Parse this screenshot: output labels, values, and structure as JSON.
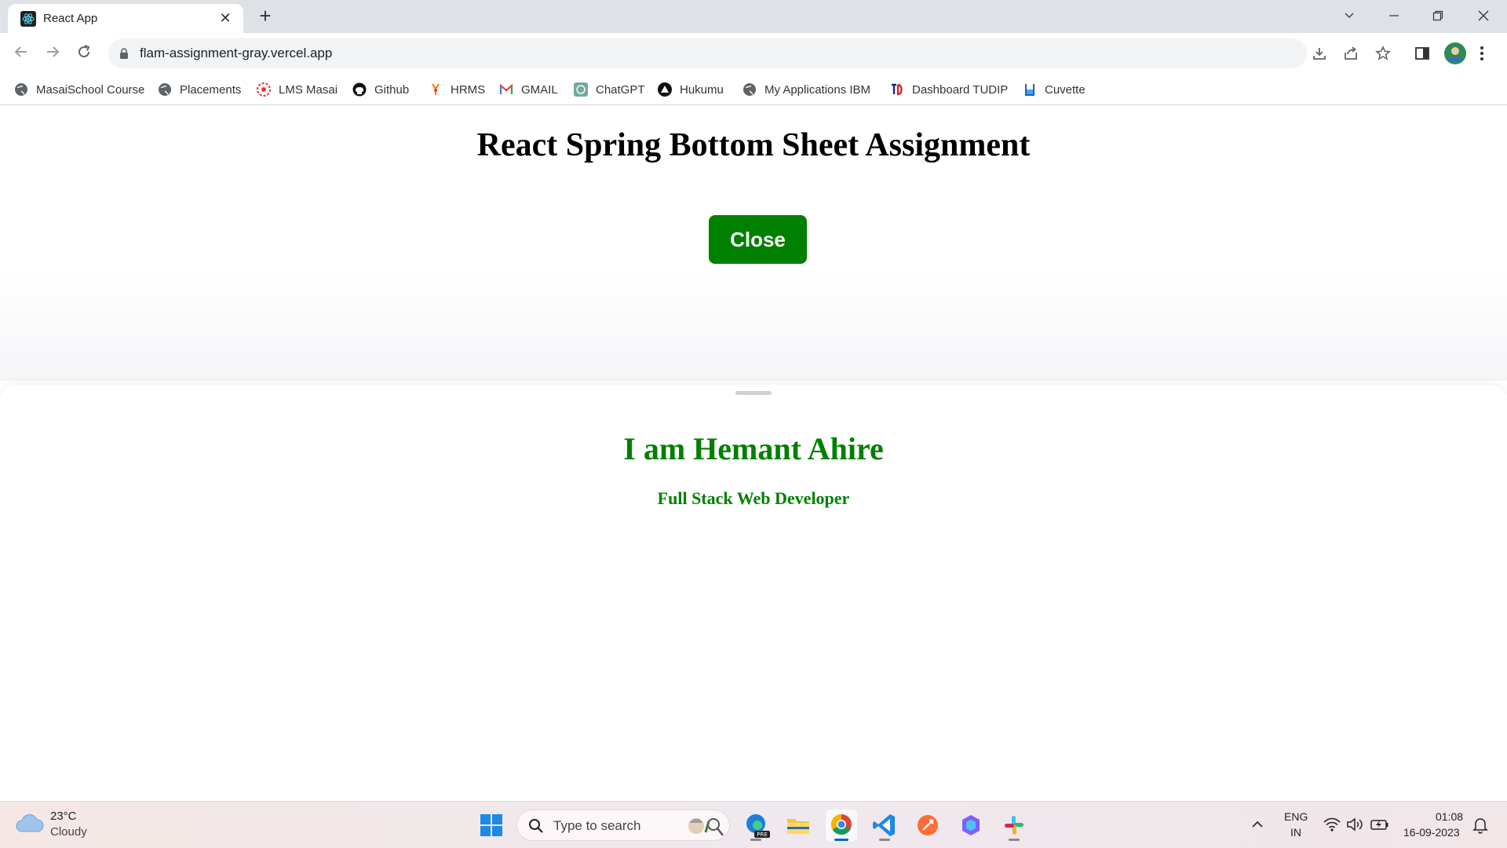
{
  "browser": {
    "tab_title": "React App",
    "tab_close": "✕",
    "new_tab": "+",
    "url": "flam-assignment-gray.vercel.app",
    "bookmarks": [
      {
        "label": "MasaiSchool Course",
        "icon": "globe-icon"
      },
      {
        "label": "Placements",
        "icon": "globe-icon"
      },
      {
        "label": "LMS Masai",
        "icon": "lms-icon"
      },
      {
        "label": "Github",
        "icon": "github-icon"
      },
      {
        "label": "HRMS",
        "icon": "hrms-icon"
      },
      {
        "label": "GMAIL",
        "icon": "gmail-icon"
      },
      {
        "label": "ChatGPT",
        "icon": "chatgpt-icon"
      },
      {
        "label": "Hukumu",
        "icon": "hukumu-icon"
      },
      {
        "label": "My Applications IBM",
        "icon": "globe-icon"
      },
      {
        "label": "Dashboard TUDIP",
        "icon": "tudip-icon"
      },
      {
        "label": "Cuvette",
        "icon": "cuvette-icon"
      }
    ]
  },
  "page": {
    "title": "React Spring Bottom Sheet Assignment",
    "close_label": "Close",
    "sheet": {
      "name": "I am Hemant Ahire",
      "role": "Full Stack Web Developer"
    }
  },
  "taskbar": {
    "weather_temp": "23°C",
    "weather_desc": "Cloudy",
    "search_placeholder": "Type to search",
    "lang_line1": "ENG",
    "lang_line2": "IN",
    "time": "01:08",
    "date": "16-09-2023"
  },
  "colors": {
    "accent_green": "#008000",
    "tab_strip": "#dee1e6"
  }
}
